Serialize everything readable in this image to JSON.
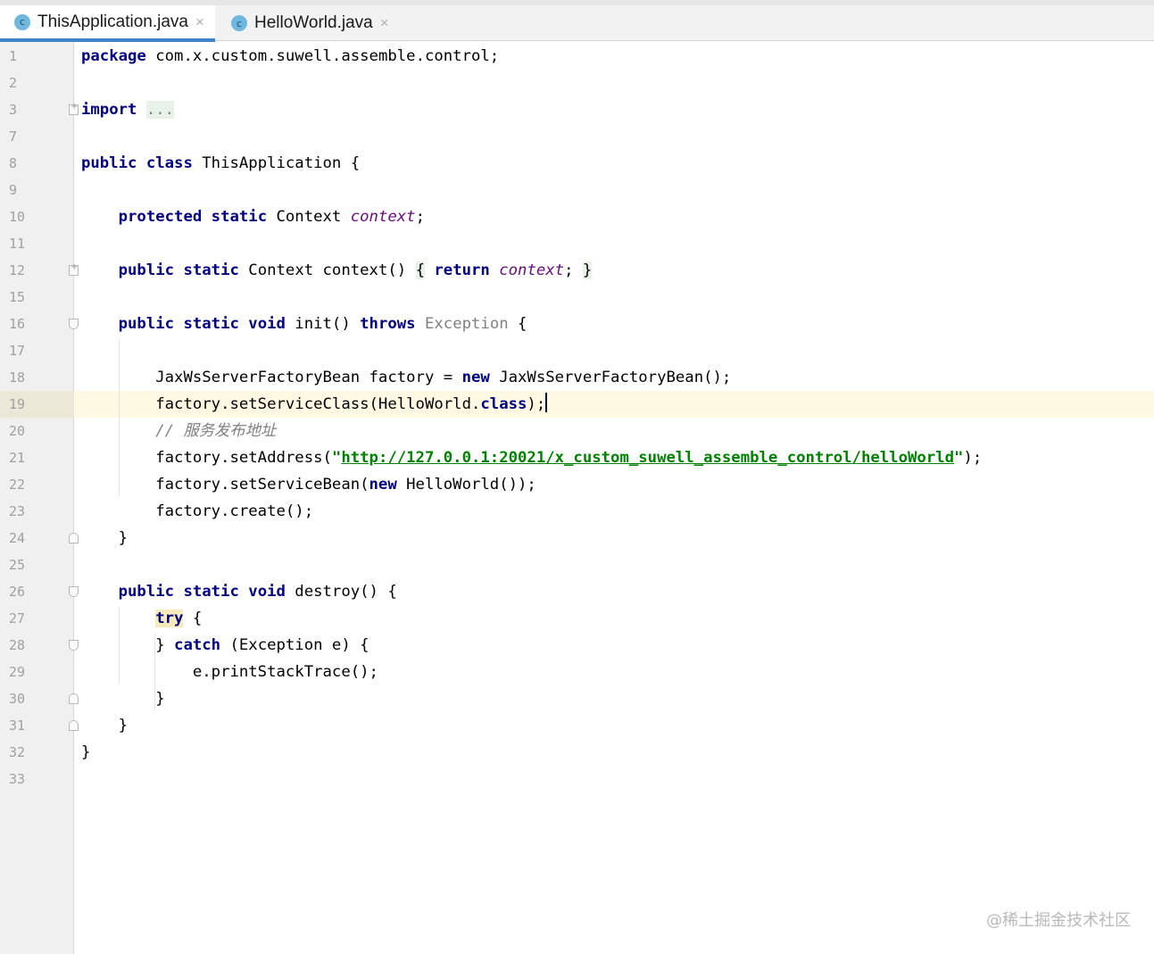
{
  "tabs": [
    {
      "icon": "c-class-icon",
      "icon_text": "c",
      "label": "ThisApplication.java",
      "close": "×",
      "active": true
    },
    {
      "icon": "c-class-icon",
      "icon_text": "c",
      "label": "HelloWorld.java",
      "close": "×",
      "active": false
    }
  ],
  "editor": {
    "caret_line": "19",
    "lines": [
      {
        "num": "1",
        "parts": [
          {
            "t": "package",
            "c": "k"
          },
          {
            "t": " com.x.custom.suwell.assemble.control;"
          }
        ]
      },
      {
        "num": "2",
        "parts": []
      },
      {
        "num": "3",
        "parts": [
          {
            "t": "import",
            "c": "k"
          },
          {
            "t": " "
          },
          {
            "t": "...",
            "c": "unused fold-hl"
          }
        ],
        "fold": "plus"
      },
      {
        "num": "7",
        "parts": []
      },
      {
        "num": "8",
        "parts": [
          {
            "t": "public class",
            "c": "k"
          },
          {
            "t": " ThisApplication {"
          }
        ]
      },
      {
        "num": "9",
        "parts": []
      },
      {
        "num": "10",
        "parts": [
          {
            "t": "    "
          },
          {
            "t": "protected static",
            "c": "k"
          },
          {
            "t": " Context "
          },
          {
            "t": "context",
            "c": "fld"
          },
          {
            "t": ";"
          }
        ]
      },
      {
        "num": "11",
        "parts": []
      },
      {
        "num": "12",
        "parts": [
          {
            "t": "    "
          },
          {
            "t": "public static",
            "c": "k"
          },
          {
            "t": " Context context() "
          },
          {
            "t": "{",
            "c": "fold-hl"
          },
          {
            "t": " "
          },
          {
            "t": "return",
            "c": "k"
          },
          {
            "t": " "
          },
          {
            "t": "context",
            "c": "fld"
          },
          {
            "t": "; "
          },
          {
            "t": "}",
            "c": "fold-hl"
          }
        ],
        "fold": "plus"
      },
      {
        "num": "15",
        "parts": []
      },
      {
        "num": "16",
        "parts": [
          {
            "t": "    "
          },
          {
            "t": "public static void",
            "c": "k"
          },
          {
            "t": " init() "
          },
          {
            "t": "throws",
            "c": "k"
          },
          {
            "t": " "
          },
          {
            "t": "Exception",
            "c": "unused"
          },
          {
            "t": " {"
          }
        ],
        "fold": "open"
      },
      {
        "num": "17",
        "parts": []
      },
      {
        "num": "18",
        "parts": [
          {
            "t": "        JaxWsServerFactoryBean factory = "
          },
          {
            "t": "new",
            "c": "k"
          },
          {
            "t": " JaxWsServerFactoryBean();"
          }
        ]
      },
      {
        "num": "19",
        "parts": [
          {
            "t": "        factory.setServiceClass(HelloWorld."
          },
          {
            "t": "class",
            "c": "k"
          },
          {
            "t": ");"
          },
          {
            "t": "",
            "c": "caret"
          }
        ]
      },
      {
        "num": "20",
        "parts": [
          {
            "t": "        "
          },
          {
            "t": "// 服务发布地址",
            "c": "cmt"
          }
        ]
      },
      {
        "num": "21",
        "parts": [
          {
            "t": "        factory.setAddress("
          },
          {
            "t": "\"",
            "c": "str"
          },
          {
            "t": "http://127.0.0.1:20021/x_custom_suwell_assemble_control/helloWorld",
            "c": "str url"
          },
          {
            "t": "\"",
            "c": "str"
          },
          {
            "t": ");"
          }
        ]
      },
      {
        "num": "22",
        "parts": [
          {
            "t": "        factory.setServiceBean("
          },
          {
            "t": "new",
            "c": "k"
          },
          {
            "t": " HelloWorld());"
          }
        ]
      },
      {
        "num": "23",
        "parts": [
          {
            "t": "        factory.create();"
          }
        ]
      },
      {
        "num": "24",
        "parts": [
          {
            "t": "    }"
          }
        ],
        "fold": "close"
      },
      {
        "num": "25",
        "parts": []
      },
      {
        "num": "26",
        "parts": [
          {
            "t": "    "
          },
          {
            "t": "public static void",
            "c": "k"
          },
          {
            "t": " destroy() {"
          }
        ],
        "fold": "open"
      },
      {
        "num": "27",
        "parts": [
          {
            "t": "        "
          },
          {
            "t": "try",
            "c": "k try-hl"
          },
          {
            "t": " {"
          }
        ]
      },
      {
        "num": "28",
        "parts": [
          {
            "t": "        } "
          },
          {
            "t": "catch",
            "c": "k"
          },
          {
            "t": " (Exception e) {"
          }
        ],
        "fold": "open"
      },
      {
        "num": "29",
        "parts": [
          {
            "t": "            e.printStackTrace();"
          }
        ]
      },
      {
        "num": "30",
        "parts": [
          {
            "t": "        }"
          }
        ],
        "fold": "close"
      },
      {
        "num": "31",
        "parts": [
          {
            "t": "    }"
          }
        ],
        "fold": "close"
      },
      {
        "num": "32",
        "parts": [
          {
            "t": "}"
          }
        ]
      },
      {
        "num": "33",
        "parts": []
      }
    ]
  },
  "watermark": "@稀土掘金技术社区"
}
